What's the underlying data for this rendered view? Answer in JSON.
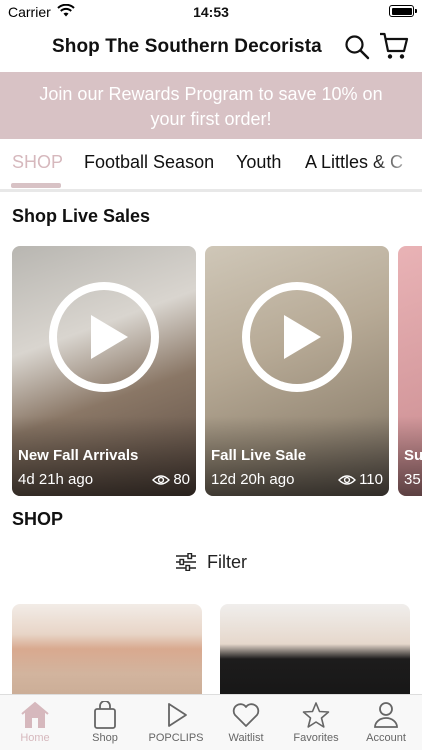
{
  "status_bar": {
    "carrier": "Carrier",
    "time": "14:53"
  },
  "header": {
    "title": "Shop The Southern Decorista",
    "search_icon": "search-icon",
    "cart_icon": "cart-icon"
  },
  "promo": {
    "text": "Join our Rewards Program to save 10% on your first order!"
  },
  "tabs": [
    {
      "label": "SHOP",
      "active": true
    },
    {
      "label": "Football Season"
    },
    {
      "label": "Youth"
    },
    {
      "label": "A Littles & C"
    }
  ],
  "live_sales": {
    "title": "Shop Live Sales",
    "cards": [
      {
        "title": "New Fall Arrivals",
        "time": "4d 21h ago",
        "views": "80"
      },
      {
        "title": "Fall Live Sale",
        "time": "12d 20h ago",
        "views": "110"
      },
      {
        "title": "Su",
        "time": "35"
      }
    ]
  },
  "shop_section": {
    "title": "SHOP",
    "filter_label": "Filter"
  },
  "bottom_nav": [
    {
      "label": "Home",
      "icon": "home-icon",
      "active": true
    },
    {
      "label": "Shop",
      "icon": "bag-icon"
    },
    {
      "label": "POPCLIPS",
      "icon": "play-icon"
    },
    {
      "label": "Waitlist",
      "icon": "heart-icon"
    },
    {
      "label": "Favorites",
      "icon": "star-icon"
    },
    {
      "label": "Account",
      "icon": "person-icon"
    }
  ],
  "colors": {
    "accent": "#d6b8bd",
    "banner": "#d8c2c5"
  }
}
